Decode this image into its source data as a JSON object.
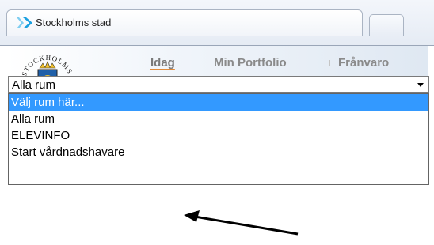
{
  "browser": {
    "tab_title": "Stockholms stad",
    "tab_icon": "double-chevron-icon"
  },
  "logo": {
    "text": "STOCKHOLMS STAD"
  },
  "nav": {
    "items": [
      "Idag",
      "Min Portfolio",
      "Frånvaro"
    ],
    "active": "Idag"
  },
  "room_select": {
    "value": "Alla rum",
    "options": [
      "Välj rum här...",
      "Alla rum",
      "ELEVINFO",
      "Start vårdnadshavare"
    ],
    "highlighted": "Välj rum här..."
  },
  "colors": {
    "highlight": "#3399ff",
    "active_underline": "#e08a3a",
    "tab_icon": "#1aa0e0"
  }
}
